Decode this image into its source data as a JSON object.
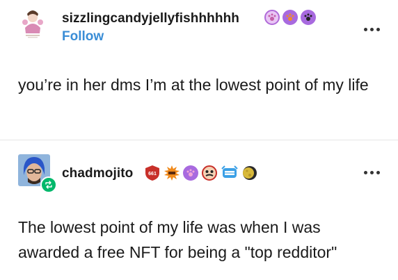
{
  "posts": [
    {
      "username": "sizzlingcandyjellyfishhhhhh",
      "follow_label": "Follow",
      "body": "you’re in her dms I’m at the lowest point of my life",
      "badges": [
        "paw-badge-pink",
        "paw-badge-orange",
        "paw-badge-black"
      ]
    },
    {
      "username": "chadmojito",
      "body": "The lowest point of my life was when I was awarded a free NFT for being a \"top redditor\"",
      "badge_count_text": "661",
      "badges": [
        "shield-badge",
        "sun-badge",
        "paw-badge-pink",
        "face-badge",
        "teeth-badge",
        "moon-badge"
      ]
    }
  ]
}
